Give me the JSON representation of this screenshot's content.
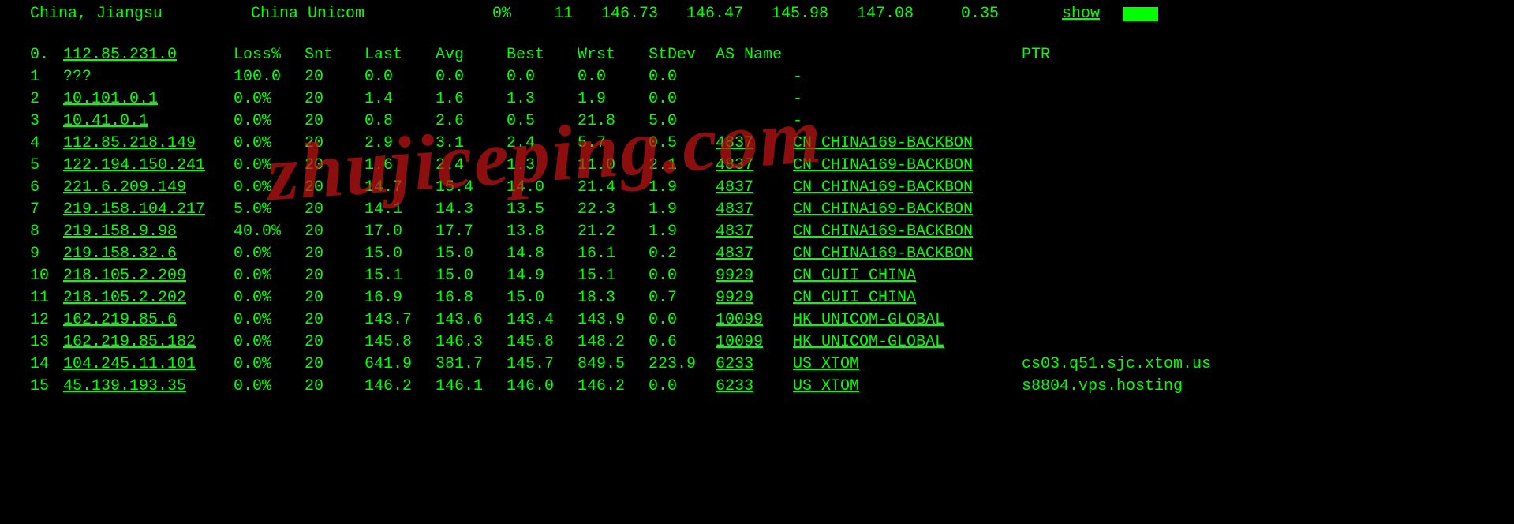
{
  "topbar": {
    "location": "China, Jiangsu",
    "isp": "China Unicom",
    "pct": "0%",
    "c1": "11",
    "n1": "146.73",
    "n2": "146.47",
    "n3": "145.98",
    "n4": "147.08",
    "n5": "0.35",
    "show": "show"
  },
  "header": {
    "hop": "0.",
    "ip": "112.85.231.0",
    "loss": "Loss%",
    "snt": "Snt",
    "last": "Last",
    "avg": "Avg",
    "best": "Best",
    "wrst": "Wrst",
    "stdev": "StDev",
    "asname": "AS Name",
    "ptr": "PTR"
  },
  "hops": [
    {
      "n": "1",
      "ip": "???",
      "loss": "100.0",
      "snt": "20",
      "last": "0.0",
      "avg": "0.0",
      "best": "0.0",
      "wrst": "0.0",
      "stdev": "0.0",
      "as": "",
      "asname": "-",
      "ptr": "",
      "ul": false
    },
    {
      "n": "2",
      "ip": "10.101.0.1",
      "loss": "0.0%",
      "snt": "20",
      "last": "1.4",
      "avg": "1.6",
      "best": "1.3",
      "wrst": "1.9",
      "stdev": "0.0",
      "as": "",
      "asname": "-",
      "ptr": "",
      "ul": true
    },
    {
      "n": "3",
      "ip": "10.41.0.1",
      "loss": "0.0%",
      "snt": "20",
      "last": "0.8",
      "avg": "2.6",
      "best": "0.5",
      "wrst": "21.8",
      "stdev": "5.0",
      "as": "",
      "asname": "-",
      "ptr": "",
      "ul": true
    },
    {
      "n": "4",
      "ip": "112.85.218.149",
      "loss": "0.0%",
      "snt": "20",
      "last": "2.9",
      "avg": "3.1",
      "best": "2.4",
      "wrst": "5.7",
      "stdev": "0.5",
      "as": "4837",
      "asname": "CN CHINA169-BACKBON",
      "ptr": "",
      "ul": true
    },
    {
      "n": "5",
      "ip": "122.194.150.241",
      "loss": "0.0%",
      "snt": "20",
      "last": "1.6",
      "avg": "2.4",
      "best": "1.3",
      "wrst": "11.0",
      "stdev": "2.1",
      "as": "4837",
      "asname": "CN CHINA169-BACKBON",
      "ptr": "",
      "ul": true
    },
    {
      "n": "6",
      "ip": "221.6.209.149",
      "loss": "0.0%",
      "snt": "20",
      "last": "14.7",
      "avg": "15.4",
      "best": "14.0",
      "wrst": "21.4",
      "stdev": "1.9",
      "as": "4837",
      "asname": "CN CHINA169-BACKBON",
      "ptr": "",
      "ul": true
    },
    {
      "n": "7",
      "ip": "219.158.104.217",
      "loss": "5.0%",
      "snt": "20",
      "last": "14.1",
      "avg": "14.3",
      "best": "13.5",
      "wrst": "22.3",
      "stdev": "1.9",
      "as": "4837",
      "asname": "CN CHINA169-BACKBON",
      "ptr": "",
      "ul": true
    },
    {
      "n": "8",
      "ip": "219.158.9.98",
      "loss": "40.0%",
      "snt": "20",
      "last": "17.0",
      "avg": "17.7",
      "best": "13.8",
      "wrst": "21.2",
      "stdev": "1.9",
      "as": "4837",
      "asname": "CN CHINA169-BACKBON",
      "ptr": "",
      "ul": true
    },
    {
      "n": "9",
      "ip": "219.158.32.6",
      "loss": "0.0%",
      "snt": "20",
      "last": "15.0",
      "avg": "15.0",
      "best": "14.8",
      "wrst": "16.1",
      "stdev": "0.2",
      "as": "4837",
      "asname": "CN CHINA169-BACKBON",
      "ptr": "",
      "ul": true
    },
    {
      "n": "10",
      "ip": "218.105.2.209",
      "loss": "0.0%",
      "snt": "20",
      "last": "15.1",
      "avg": "15.0",
      "best": "14.9",
      "wrst": "15.1",
      "stdev": "0.0",
      "as": "9929",
      "asname": "CN CUII CHINA",
      "ptr": "",
      "ul": true
    },
    {
      "n": "11",
      "ip": "218.105.2.202",
      "loss": "0.0%",
      "snt": "20",
      "last": "16.9",
      "avg": "16.8",
      "best": "15.0",
      "wrst": "18.3",
      "stdev": "0.7",
      "as": "9929",
      "asname": "CN CUII CHINA",
      "ptr": "",
      "ul": true
    },
    {
      "n": "12",
      "ip": "162.219.85.6",
      "loss": "0.0%",
      "snt": "20",
      "last": "143.7",
      "avg": "143.6",
      "best": "143.4",
      "wrst": "143.9",
      "stdev": "0.0",
      "as": "10099",
      "asname": "HK UNICOM-GLOBAL",
      "ptr": "",
      "ul": true
    },
    {
      "n": "13",
      "ip": "162.219.85.182",
      "loss": "0.0%",
      "snt": "20",
      "last": "145.8",
      "avg": "146.3",
      "best": "145.8",
      "wrst": "148.2",
      "stdev": "0.6",
      "as": "10099",
      "asname": "HK UNICOM-GLOBAL",
      "ptr": "",
      "ul": true
    },
    {
      "n": "14",
      "ip": "104.245.11.101",
      "loss": "0.0%",
      "snt": "20",
      "last": "641.9",
      "avg": "381.7",
      "best": "145.7",
      "wrst": "849.5",
      "stdev": "223.9",
      "as": "6233",
      "asname": "US XTOM",
      "ptr": "cs03.q51.sjc.xtom.us",
      "ul": true
    },
    {
      "n": "15",
      "ip": "45.139.193.35",
      "loss": "0.0%",
      "snt": "20",
      "last": "146.2",
      "avg": "146.1",
      "best": "146.0",
      "wrst": "146.2",
      "stdev": "0.0",
      "as": "6233",
      "asname": "US XTOM",
      "ptr": "s8804.vps.hosting",
      "ul": true
    }
  ],
  "watermark": "zhujiceping.com"
}
